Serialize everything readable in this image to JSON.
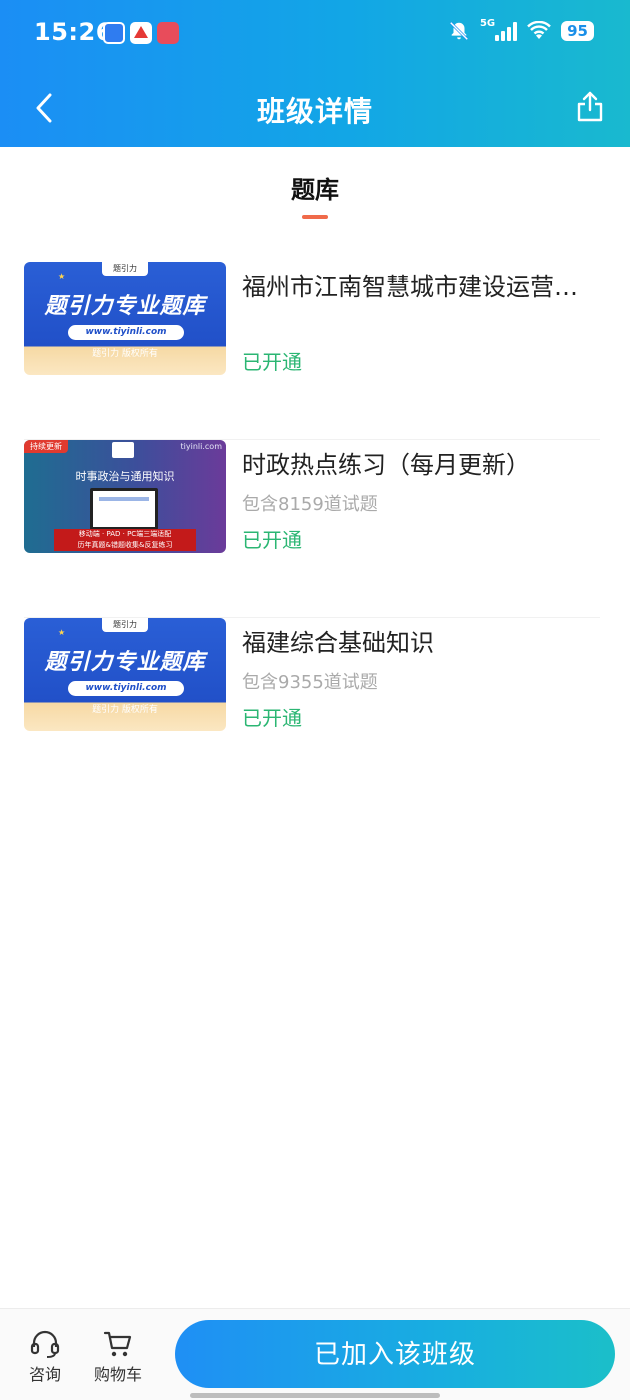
{
  "status_bar": {
    "time": "15:26",
    "battery": "95",
    "network": "5G",
    "icons": [
      "bell-mute-icon",
      "signal-icon",
      "wifi-icon",
      "battery-icon"
    ]
  },
  "header": {
    "title": "班级详情",
    "back_icon": "chevron-left-icon",
    "share_icon": "share-icon"
  },
  "section": {
    "tab_label": "题库"
  },
  "items": [
    {
      "title": "福州市江南智慧城市建设运营…",
      "subtitle": "",
      "status": "已开通",
      "thumb": {
        "headline": "题引力专业题库",
        "url": "www.tiyinli.com",
        "copyright": "题引力 版权所有",
        "logo": "题引力"
      }
    },
    {
      "title": "时政热点练习（每月更新）",
      "subtitle": "包含8159道试题",
      "status": "已开通",
      "thumb": {
        "tag": "持续更新",
        "site": "tiyinli.com",
        "headline": "时事政治与通用知识",
        "band_line1": "移动端 · PAD · PC端三端适配",
        "band_line2": "历年真题&错题收集&反复练习"
      }
    },
    {
      "title": "福建综合基础知识",
      "subtitle": "包含9355道试题",
      "status": "已开通",
      "thumb": {
        "headline": "题引力专业题库",
        "url": "www.tiyinli.com",
        "copyright": "题引力 版权所有",
        "logo": "题引力"
      }
    }
  ],
  "bottom_bar": {
    "consult_label": "咨询",
    "cart_label": "购物车",
    "join_button": "已加入该班级"
  },
  "colors": {
    "header_gradient_start": "#1b8ef5",
    "header_gradient_end": "#19b9cf",
    "status_green": "#2bb673",
    "tab_underline": "#f06a4a"
  }
}
